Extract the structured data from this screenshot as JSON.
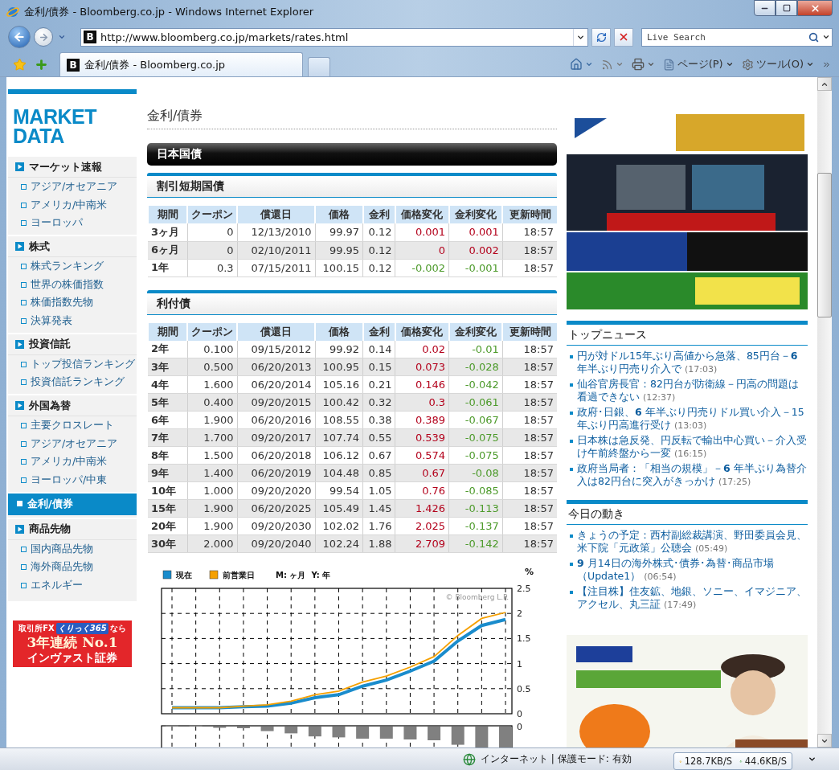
{
  "window": {
    "title": "金利/債券 - Bloomberg.co.jp - Windows Internet Explorer"
  },
  "address_bar": {
    "site_icon": "B",
    "url": "http://www.bloomberg.co.jp/markets/rates.html"
  },
  "search": {
    "placeholder": "Live Search"
  },
  "tabs": [
    {
      "site_icon": "B",
      "label": "金利/債券 - Bloomberg.co.jp",
      "selected": true
    }
  ],
  "command_bar": {
    "page_menu": "ページ(P)",
    "tools_menu": "ツール(O)"
  },
  "sidebar": {
    "logo": "MARKET DATA",
    "sections": [
      {
        "label": "マーケット速報",
        "selected": false,
        "children": [
          {
            "label": "アジア/オセアニア",
            "selected": false
          },
          {
            "label": "アメリカ/中南米",
            "selected": false
          },
          {
            "label": "ヨーロッパ",
            "selected": false
          }
        ]
      },
      {
        "label": "株式",
        "selected": false,
        "children": [
          {
            "label": "株式ランキング",
            "selected": false
          },
          {
            "label": "世界の株価指数",
            "selected": false
          },
          {
            "label": "株価指数先物",
            "selected": false
          },
          {
            "label": "決算発表",
            "selected": false
          }
        ]
      },
      {
        "label": "投資信託",
        "selected": false,
        "children": [
          {
            "label": "トップ投信ランキング",
            "selected": false
          },
          {
            "label": "投資信託ランキング",
            "selected": false
          }
        ]
      },
      {
        "label": "外国為替",
        "selected": false,
        "children": [
          {
            "label": "主要クロスレート",
            "selected": false
          },
          {
            "label": "アジア/オセアニア",
            "selected": false
          },
          {
            "label": "アメリカ/中南米",
            "selected": false
          },
          {
            "label": "ヨーロッパ/中東",
            "selected": false
          }
        ]
      },
      {
        "label": "金利/債券",
        "selected": true
      },
      {
        "label": "商品先物",
        "selected": false,
        "children": [
          {
            "label": "国内商品先物",
            "selected": false
          },
          {
            "label": "海外商品先物",
            "selected": false
          },
          {
            "label": "エネルギー",
            "selected": false
          }
        ]
      }
    ]
  },
  "sidebar_banner": {
    "lead": "取引所FX",
    "badge": "くりっく365",
    "lead_suffix": "なら",
    "headline": "3年連続 No.1",
    "company": "インヴァスト証券"
  },
  "main": {
    "title": "金利/債券",
    "band": "日本国債",
    "tables": [
      {
        "title": "割引短期国債",
        "columns": [
          "期間",
          "クーポン",
          "償還日",
          "価格",
          "金利",
          "価格変化",
          "金利変化",
          "更新時間"
        ],
        "rows": [
          {
            "term": "3ヶ月",
            "coupon": "0",
            "maturity": "12/13/2010",
            "price": "99.97",
            "yield": "0.12",
            "price_change": {
              "value": "0.001",
              "up": true
            },
            "yield_change": {
              "value": "0.001",
              "up": true
            },
            "time": "18:57"
          },
          {
            "term": "6ヶ月",
            "coupon": "0",
            "maturity": "02/10/2011",
            "price": "99.95",
            "yield": "0.12",
            "price_change": {
              "value": "0",
              "up": true
            },
            "yield_change": {
              "value": "0.002",
              "up": true
            },
            "time": "18:57"
          },
          {
            "term": "1年",
            "coupon": "0.3",
            "maturity": "07/15/2011",
            "price": "100.15",
            "yield": "0.12",
            "price_change": {
              "value": "-0.002",
              "up": false
            },
            "yield_change": {
              "value": "-0.001",
              "up": false
            },
            "time": "18:57"
          }
        ]
      },
      {
        "title": "利付債",
        "columns": [
          "期間",
          "クーポン",
          "償還日",
          "価格",
          "金利",
          "価格変化",
          "金利変化",
          "更新時間"
        ],
        "rows": [
          {
            "term": "2年",
            "coupon": "0.100",
            "maturity": "09/15/2012",
            "price": "99.92",
            "yield": "0.14",
            "price_change": {
              "value": "0.02",
              "up": true
            },
            "yield_change": {
              "value": "-0.01",
              "up": false
            },
            "time": "18:57"
          },
          {
            "term": "3年",
            "coupon": "0.500",
            "maturity": "06/20/2013",
            "price": "100.95",
            "yield": "0.15",
            "price_change": {
              "value": "0.073",
              "up": true
            },
            "yield_change": {
              "value": "-0.028",
              "up": false
            },
            "time": "18:57"
          },
          {
            "term": "4年",
            "coupon": "1.600",
            "maturity": "06/20/2014",
            "price": "105.16",
            "yield": "0.21",
            "price_change": {
              "value": "0.146",
              "up": true
            },
            "yield_change": {
              "value": "-0.042",
              "up": false
            },
            "time": "18:57"
          },
          {
            "term": "5年",
            "coupon": "0.400",
            "maturity": "09/20/2015",
            "price": "100.42",
            "yield": "0.32",
            "price_change": {
              "value": "0.3",
              "up": true
            },
            "yield_change": {
              "value": "-0.061",
              "up": false
            },
            "time": "18:57"
          },
          {
            "term": "6年",
            "coupon": "1.900",
            "maturity": "06/20/2016",
            "price": "108.55",
            "yield": "0.38",
            "price_change": {
              "value": "0.389",
              "up": true
            },
            "yield_change": {
              "value": "-0.067",
              "up": false
            },
            "time": "18:57"
          },
          {
            "term": "7年",
            "coupon": "1.700",
            "maturity": "09/20/2017",
            "price": "107.74",
            "yield": "0.55",
            "price_change": {
              "value": "0.539",
              "up": true
            },
            "yield_change": {
              "value": "-0.075",
              "up": false
            },
            "time": "18:57"
          },
          {
            "term": "8年",
            "coupon": "1.500",
            "maturity": "06/20/2018",
            "price": "106.12",
            "yield": "0.67",
            "price_change": {
              "value": "0.574",
              "up": true
            },
            "yield_change": {
              "value": "-0.075",
              "up": false
            },
            "time": "18:57"
          },
          {
            "term": "9年",
            "coupon": "1.400",
            "maturity": "06/20/2019",
            "price": "104.48",
            "yield": "0.85",
            "price_change": {
              "value": "0.67",
              "up": true
            },
            "yield_change": {
              "value": "-0.08",
              "up": false
            },
            "time": "18:57"
          },
          {
            "term": "10年",
            "coupon": "1.000",
            "maturity": "09/20/2020",
            "price": "99.54",
            "yield": "1.05",
            "price_change": {
              "value": "0.76",
              "up": true
            },
            "yield_change": {
              "value": "-0.085",
              "up": false
            },
            "time": "18:57"
          },
          {
            "term": "15年",
            "coupon": "1.900",
            "maturity": "06/20/2025",
            "price": "105.49",
            "yield": "1.45",
            "price_change": {
              "value": "1.426",
              "up": true
            },
            "yield_change": {
              "value": "-0.113",
              "up": false
            },
            "time": "18:57"
          },
          {
            "term": "20年",
            "coupon": "1.900",
            "maturity": "09/20/2030",
            "price": "102.02",
            "yield": "1.76",
            "price_change": {
              "value": "2.025",
              "up": true
            },
            "yield_change": {
              "value": "-0.137",
              "up": false
            },
            "time": "18:57"
          },
          {
            "term": "30年",
            "coupon": "2.000",
            "maturity": "09/20/2040",
            "price": "102.24",
            "yield": "1.88",
            "price_change": {
              "value": "2.709",
              "up": true
            },
            "yield_change": {
              "value": "-0.142",
              "up": false
            },
            "time": "18:57"
          }
        ]
      }
    ]
  },
  "yield_chart": {
    "legend_note": "M: ヶ月  Y: 年",
    "credit": "© Bloomberg L.P.",
    "chart_data": {
      "type": "line",
      "ylabel": "%",
      "categories": [
        null,
        null,
        null,
        null,
        null,
        null,
        null,
        null,
        null,
        null,
        null,
        null,
        null,
        null,
        null
      ],
      "grid": true,
      "legend": true,
      "ylim": [
        0,
        2.5
      ],
      "yticks": [
        {
          "value": 0,
          "label": "0"
        },
        {
          "value": 0.5,
          "label": "0.5"
        },
        {
          "value": 1,
          "label": "1"
        },
        {
          "value": 1.5,
          "label": "1.5"
        },
        {
          "value": 2,
          "label": "2"
        },
        {
          "value": 2.5,
          "label": "2.5"
        }
      ],
      "series": [
        {
          "name": "現在",
          "color": "#1a8ccc",
          "values": [
            0.12,
            0.12,
            0.12,
            0.14,
            0.15,
            0.21,
            0.32,
            0.38,
            0.55,
            0.67,
            0.85,
            1.05,
            1.45,
            1.76,
            1.88
          ]
        },
        {
          "name": "前営業日",
          "color": "#f5a000",
          "values": [
            0.12,
            0.12,
            0.12,
            0.15,
            0.18,
            0.25,
            0.38,
            0.45,
            0.63,
            0.75,
            0.93,
            1.14,
            1.56,
            1.9,
            2.02
          ]
        }
      ]
    }
  },
  "change_chart": {
    "tick": "0"
  },
  "right_column": {
    "news_sections": [
      {
        "title": "トップニュース",
        "items": [
          {
            "text": "円が対ドル15年ぶり高値から急落、85円台－**6** 年半ぶり円売り介入で",
            "time": "(17:03)"
          },
          {
            "text": "仙谷官房長官：82円台が防衛線－円高の問題は看過できない",
            "time": "(12:37)"
          },
          {
            "text": "政府･日銀、**6** 年半ぶり円売りドル買い介入－15年ぶり円高進行受け",
            "time": "(13:03)"
          },
          {
            "text": "日本株は急反発、円反転で輸出中心買い－介入受け午前終盤から一変",
            "time": "(16:15)"
          },
          {
            "text": "政府当局者：「相当の規模」－**6** 年半ぶり為替介入は82円台に突入がきっかけ",
            "time": "(17:25)"
          }
        ]
      },
      {
        "title": "今日の動き",
        "items": [
          {
            "text": "きょうの予定：西村副総裁講演、野田委員会見、米下院「元政策」公聴会",
            "time": "(05:49)"
          },
          {
            "text": "**9** 月14日の海外株式･債券･為替･商品市場（Update1）",
            "time": "(06:54)"
          },
          {
            "text": "【注目株】住友鉱、地銀、ソニー、イマジニア、アクセル、丸三証",
            "time": "(17:49)"
          }
        ]
      }
    ]
  },
  "status_bar": {
    "zone": "インターネット | 保護モード: 有効",
    "download": "128.7KB/S",
    "upload": "44.6KB/S"
  }
}
